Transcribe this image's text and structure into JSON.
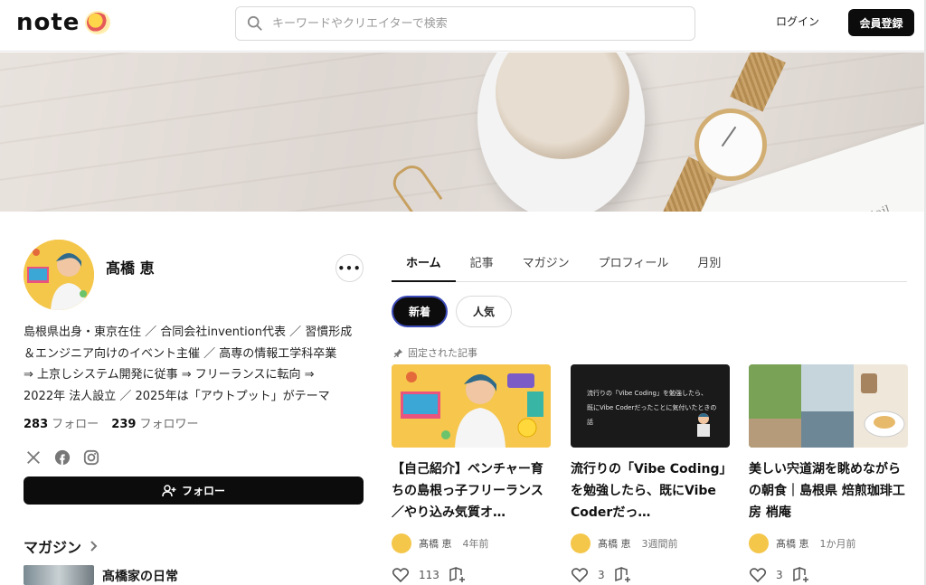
{
  "header": {
    "logo": "note",
    "search_placeholder": "キーワードやクリエイターで検索",
    "login_label": "ログイン",
    "signup_label": "会員登録"
  },
  "banner": {
    "book_text": "Goal Detail"
  },
  "profile": {
    "name": "髙橋 恵",
    "more_label": "•••",
    "bio_lines": [
      "島根県出身・東京在住 ／ 合同会社invention代表 ／ 習慣形成",
      "＆エンジニア向けのイベント主催 ／ 高専の情報工学科卒業",
      "⇒ 上京しシステム開発に従事 ⇒ フリーランスに転向 ⇒",
      "2022年 法人設立 ／ 2025年は「アウトプット」がテーマ"
    ],
    "following_count": "283",
    "following_label": "フォロー",
    "followers_count": "239",
    "followers_label": "フォロワー",
    "follow_button": "フォロー"
  },
  "magazine": {
    "heading": "マガジン",
    "first_title": "髙橋家の日常"
  },
  "tabs": [
    "ホーム",
    "記事",
    "マガジン",
    "プロフィール",
    "月別"
  ],
  "filters": {
    "new": "新着",
    "popular": "人気"
  },
  "pinned_label": "固定された記事",
  "cards": [
    {
      "title": "【自己紹介】ベンチャー育ちの島根っ子フリーランス／やり込み気質オ…",
      "author": "髙橋 恵",
      "date": "4年前",
      "likes": "113"
    },
    {
      "title": "流行りの「Vibe Coding」を勉強したら、既にVibe Coderだっ…",
      "author": "髙橋 恵",
      "date": "3週間前",
      "likes": "3",
      "thumb_line1": "流行りの「Vibe Coding」を勉強したら、",
      "thumb_line2": "既にVibe Coderだったことに気付いたときの話"
    },
    {
      "title": "美しい宍道湖を眺めながらの朝食｜島根県 焙煎珈琲工房 梢庵",
      "author": "髙橋 恵",
      "date": "1か月前",
      "likes": "3"
    }
  ]
}
